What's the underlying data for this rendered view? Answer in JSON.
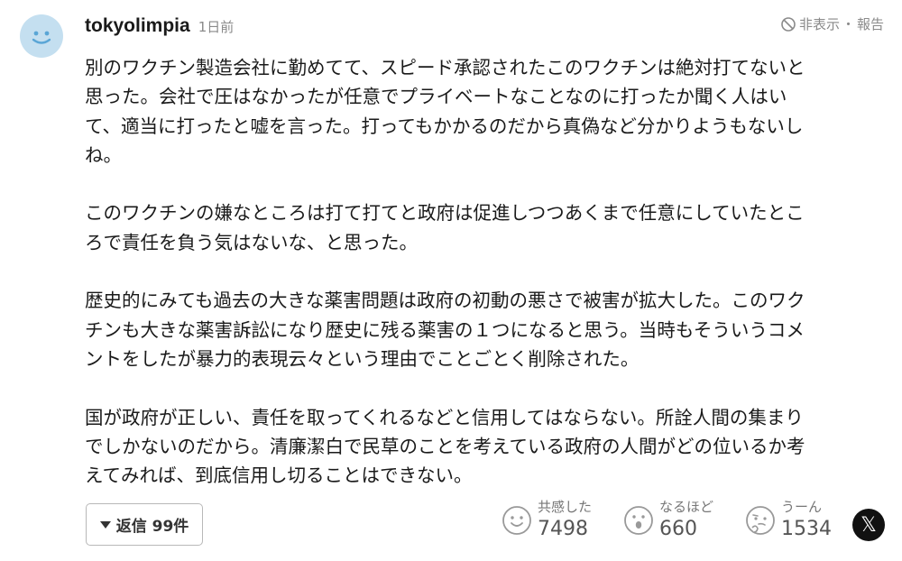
{
  "comment": {
    "username": "tokyolimpia",
    "timestamp": "1日前",
    "actions": {
      "hide_label": "非表示",
      "separator": "・",
      "report_label": "報告"
    },
    "paragraphs": [
      [
        "別のワクチン製造会社に勤めてて、スピード承認されたこのワクチンは絶対打てないと",
        "思った。会社で圧はなかったが任意でプライベートなことなのに打ったか聞く人はい",
        "て、適当に打ったと嘘を言った。打ってもかかるのだから真偽など分かりようもないし",
        "ね。"
      ],
      [
        "このワクチンの嫌なところは打て打てと政府は促進しつつあくまで任意にしていたとこ",
        "ろで責任を負う気はないな、と思った。"
      ],
      [
        "歴史的にみても過去の大きな薬害問題は政府の初動の悪さで被害が拡大した。このワク",
        "チンも大きな薬害訴訟になり歴史に残る薬害の１つになると思う。当時もそういうコメ",
        "ントをしたが暴力的表現云々という理由でことごとく削除された。"
      ],
      [
        "国が政府が正しい、責任を取ってくれるなどと信用してはならない。所詮人間の集まり",
        "でしかないのだから。清廉潔白で民草のことを考えている政府の人間がどの位いるか考",
        "えてみれば、到底信用し切ることはできない。"
      ]
    ],
    "reply_button": {
      "label": "返信 99件"
    },
    "reactions": [
      {
        "icon": "smile-face-icon",
        "label": "共感した",
        "count": "7498"
      },
      {
        "icon": "surprised-face-icon",
        "label": "なるほど",
        "count": "660"
      },
      {
        "icon": "thinking-face-icon",
        "label": "うーん",
        "count": "1534"
      }
    ],
    "share": {
      "icon": "x-logo-icon",
      "glyph": "𝕏"
    }
  }
}
